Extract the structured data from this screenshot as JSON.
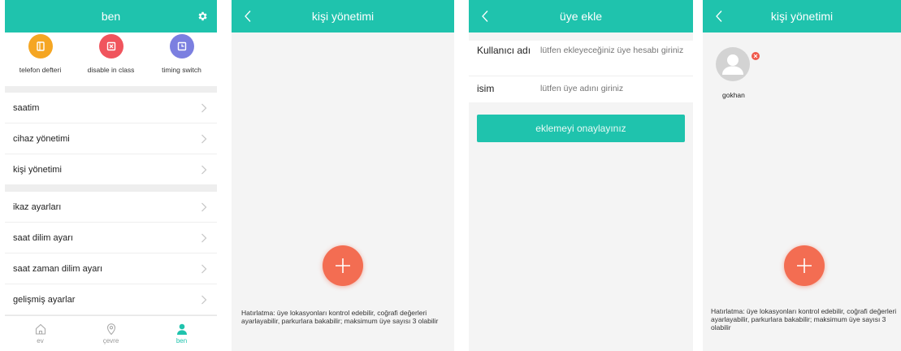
{
  "screen1": {
    "title": "ben",
    "tiles": [
      {
        "label": "telefon defteri",
        "icon": "phone-book-icon",
        "color": "#f5a623"
      },
      {
        "label": "disable in class",
        "icon": "disable-icon",
        "color": "#f0545d"
      },
      {
        "label": "timing switch",
        "icon": "clock-icon",
        "color": "#7b7fe0"
      }
    ],
    "group1": [
      "saatim",
      "cihaz yönetimi",
      "kişi yönetimi"
    ],
    "group2": [
      "ikaz ayarları",
      "saat dilim ayarı",
      "saat zaman dilim ayarı",
      "gelişmiş ayarlar"
    ],
    "tabs": [
      {
        "label": "ev",
        "icon": "home-icon"
      },
      {
        "label": "çevre",
        "icon": "location-pin-icon"
      },
      {
        "label": "ben",
        "icon": "person-icon"
      }
    ],
    "active_tab": "ben"
  },
  "screen2": {
    "title": "kişi yönetimi",
    "note": "Hatırlatma: üye lokasyonları kontrol edebilir, coğrafi değerleri ayarlayabilir, parkurlara bakabilir; maksimum üye sayısı 3 olabilir"
  },
  "screen3": {
    "title": "üye ekle",
    "username_label": "Kullanıcı adı",
    "username_placeholder": "lütfen ekleyeceğiniz üye hesabı giriniz",
    "name_label": "isim",
    "name_placeholder": "lütfen üye adını giriniz",
    "confirm_label": "eklemeyi onaylayınız"
  },
  "screen4": {
    "title": "kişi yönetimi",
    "member_name": "gokhan",
    "note": "Hatırlatma: üye lokasyonları kontrol edebilir, coğrafi değerleri ayarlayabilir, parkurlara bakabilir; maksimum üye sayısı 3 olabilir"
  },
  "colors": {
    "accent": "#1fc3ad",
    "fab": "#f36d52",
    "delete": "#f0584a"
  }
}
